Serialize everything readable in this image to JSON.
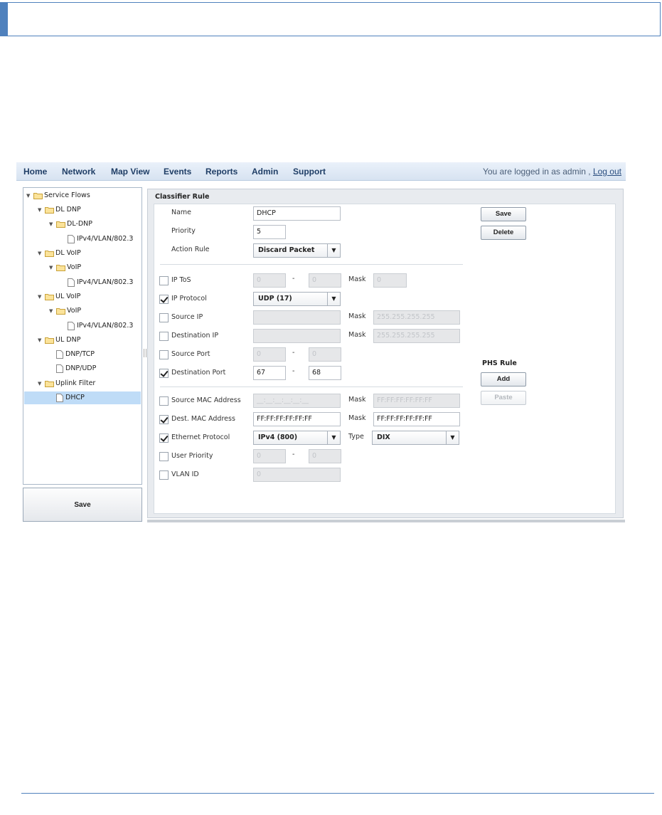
{
  "menu": {
    "items": [
      "Home",
      "Network",
      "Map View",
      "Events",
      "Reports",
      "Admin",
      "Support"
    ],
    "login_text": "You are logged in as admin ,",
    "logout_label": "Log out"
  },
  "tree": {
    "nodes": [
      {
        "label": "Service Flows",
        "type": "folder"
      },
      {
        "label": "DL DNP",
        "type": "folder"
      },
      {
        "label": "DL-DNP",
        "type": "folder"
      },
      {
        "label": "IPv4/VLAN/802.3",
        "type": "file"
      },
      {
        "label": "DL VoIP",
        "type": "folder"
      },
      {
        "label": "VoIP",
        "type": "folder"
      },
      {
        "label": "IPv4/VLAN/802.3",
        "type": "file"
      },
      {
        "label": "UL VoIP",
        "type": "folder"
      },
      {
        "label": "VoIP",
        "type": "folder"
      },
      {
        "label": "IPv4/VLAN/802.3",
        "type": "file"
      },
      {
        "label": "UL DNP",
        "type": "folder"
      },
      {
        "label": "DNP/TCP",
        "type": "file"
      },
      {
        "label": "DNP/UDP",
        "type": "file"
      },
      {
        "label": "Uplink Filter",
        "type": "folder"
      },
      {
        "label": "DHCP",
        "type": "file",
        "selected": true
      }
    ],
    "save_label": "Save"
  },
  "classifier": {
    "title": "Classifier Rule",
    "name_label": "Name",
    "name_value": "DHCP",
    "priority_label": "Priority",
    "priority_value": "5",
    "action_label": "Action Rule",
    "action_value": "Discard Packet",
    "save_label": "Save",
    "delete_label": "Delete",
    "mask_label": "Mask",
    "type_label": "Type",
    "range_sep": "-",
    "ip_tos": {
      "label": "IP ToS",
      "checked": false,
      "from": "0",
      "to": "0",
      "mask": "0"
    },
    "ip_protocol": {
      "label": "IP Protocol",
      "checked": true,
      "value": "UDP (17)"
    },
    "source_ip": {
      "label": "Source IP",
      "checked": false,
      "value": "",
      "mask": "255.255.255.255"
    },
    "destination_ip": {
      "label": "Destination IP",
      "checked": false,
      "value": "",
      "mask": "255.255.255.255"
    },
    "source_port": {
      "label": "Source Port",
      "checked": false,
      "from": "0",
      "to": "0"
    },
    "destination_port": {
      "label": "Destination Port",
      "checked": true,
      "from": "67",
      "to": "68"
    },
    "source_mac": {
      "label": "Source MAC Address",
      "checked": false,
      "value": "__:__:__:__:__:__",
      "mask": "FF:FF:FF:FF:FF:FF"
    },
    "dest_mac": {
      "label": "Dest. MAC Address",
      "checked": true,
      "value": "FF:FF:FF:FF:FF:FF",
      "mask": "FF:FF:FF:FF:FF:FF"
    },
    "ethernet_protocol": {
      "label": "Ethernet Protocol",
      "checked": true,
      "value": "IPv4 (800)",
      "type_value": "DIX"
    },
    "user_priority": {
      "label": "User Priority",
      "checked": false,
      "from": "0",
      "to": "0"
    },
    "vlan_id": {
      "label": "VLAN ID",
      "checked": false,
      "value": "0"
    }
  },
  "phs": {
    "title": "PHS Rule",
    "add_label": "Add",
    "paste_label": "Paste"
  }
}
